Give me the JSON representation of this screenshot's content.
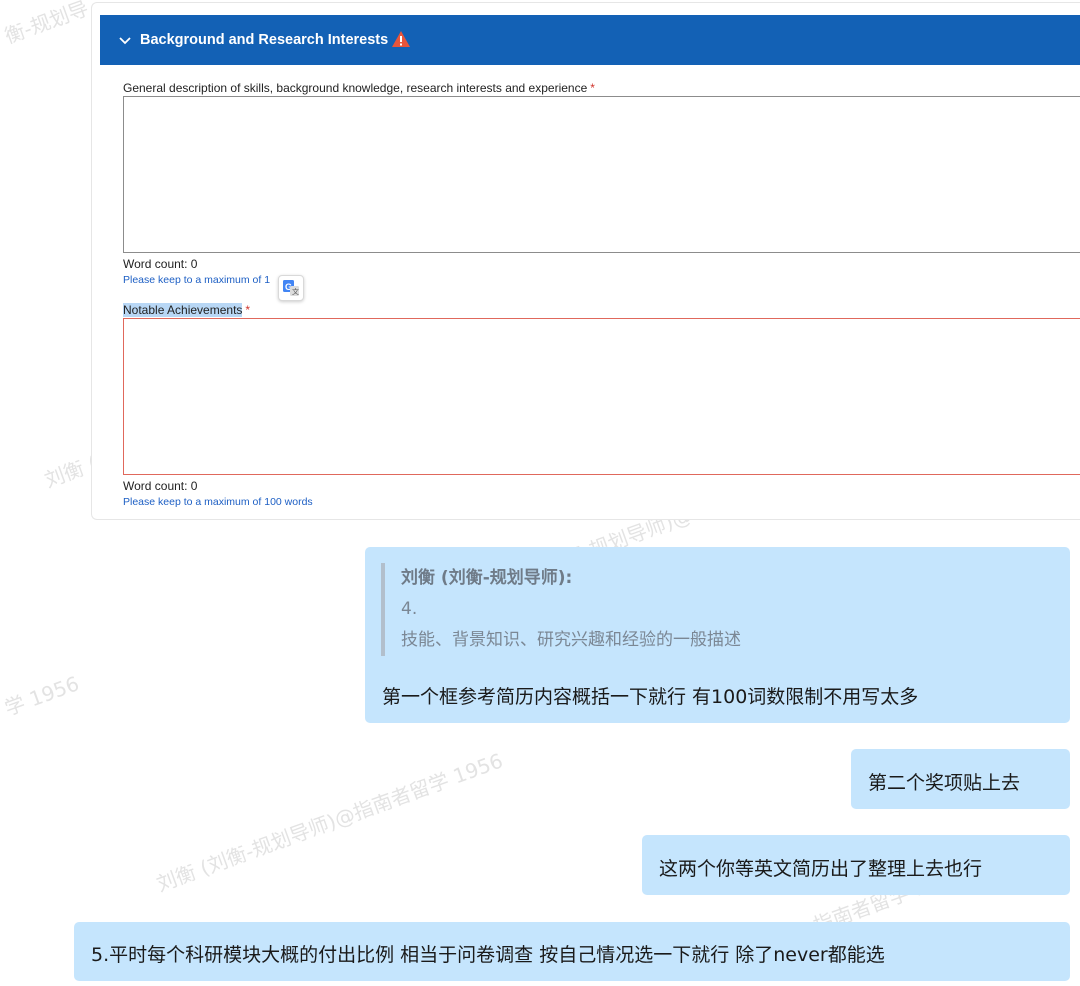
{
  "form": {
    "section_title": "Background and Research Interests",
    "field1": {
      "label": "General description of skills, background knowledge, research interests and experience",
      "required_mark": "*",
      "value": "",
      "word_count": "Word count: 0",
      "hint": "Please keep to a maximum of 1 ords"
    },
    "field2": {
      "label": "Notable Achievements",
      "required_mark": "*",
      "value": "",
      "word_count": "Word count: 0",
      "hint": "Please keep to a maximum of 100 words"
    }
  },
  "chat": {
    "message1": {
      "quote_author": "刘衡 (刘衡-规划导师):",
      "quote_line1": "4.",
      "quote_line2": "技能、背景知识、研究兴趣和经验的一般描述",
      "text": "第一个框参考简历内容概括一下就行 有100词数限制不用写太多"
    },
    "message2": {
      "text": "第二个奖项贴上去"
    },
    "message3": {
      "text": "这两个你等英文简历出了整理上去也行"
    },
    "message4": {
      "text": "5.平时每个科研模块大概的付出比例 相当于问卷调查 按自己情况选一下就行 除了never都能选"
    }
  },
  "watermarks": [
    "衡-规划导",
    "刘衡 (",
    "学 1956",
    "刘衡 (刘衡-规划导师)@指南者留学 1956",
    "刘衡-规划导师)@",
    "@指南者留学 19"
  ],
  "colors": {
    "header_bg": "#1361b5",
    "bubble_bg": "#c5e5fd",
    "required": "#d0342c",
    "hint_link": "#1d5fc4",
    "error_border": "#e0685c"
  }
}
